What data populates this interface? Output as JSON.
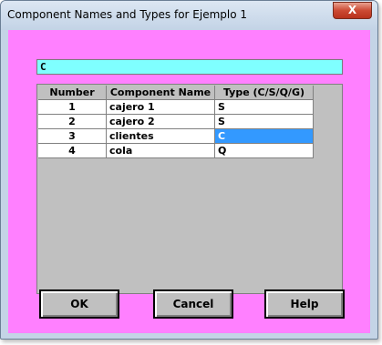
{
  "window": {
    "title": "Component Names and Types for Ejemplo 1",
    "close_glyph": "X"
  },
  "editor": {
    "current_value": "C"
  },
  "table": {
    "headers": [
      "Number",
      "Component Name",
      "Type (C/S/Q/G)"
    ],
    "rows": [
      {
        "number": "1",
        "name": "cajero 1",
        "type": "S"
      },
      {
        "number": "2",
        "name": "cajero 2",
        "type": "S"
      },
      {
        "number": "3",
        "name": "clientes",
        "type": "C"
      },
      {
        "number": "4",
        "name": "cola",
        "type": "Q"
      }
    ],
    "selected_cell": {
      "row": 3,
      "column": "type"
    }
  },
  "buttons": {
    "ok": "OK",
    "cancel": "Cancel",
    "help": "Help"
  },
  "colors": {
    "client_background": "#ff80ff",
    "input_background": "#7fffff",
    "selection": "#3399ff",
    "grid_background": "#c0c0c0"
  },
  "icons": {
    "close": "close-icon"
  }
}
